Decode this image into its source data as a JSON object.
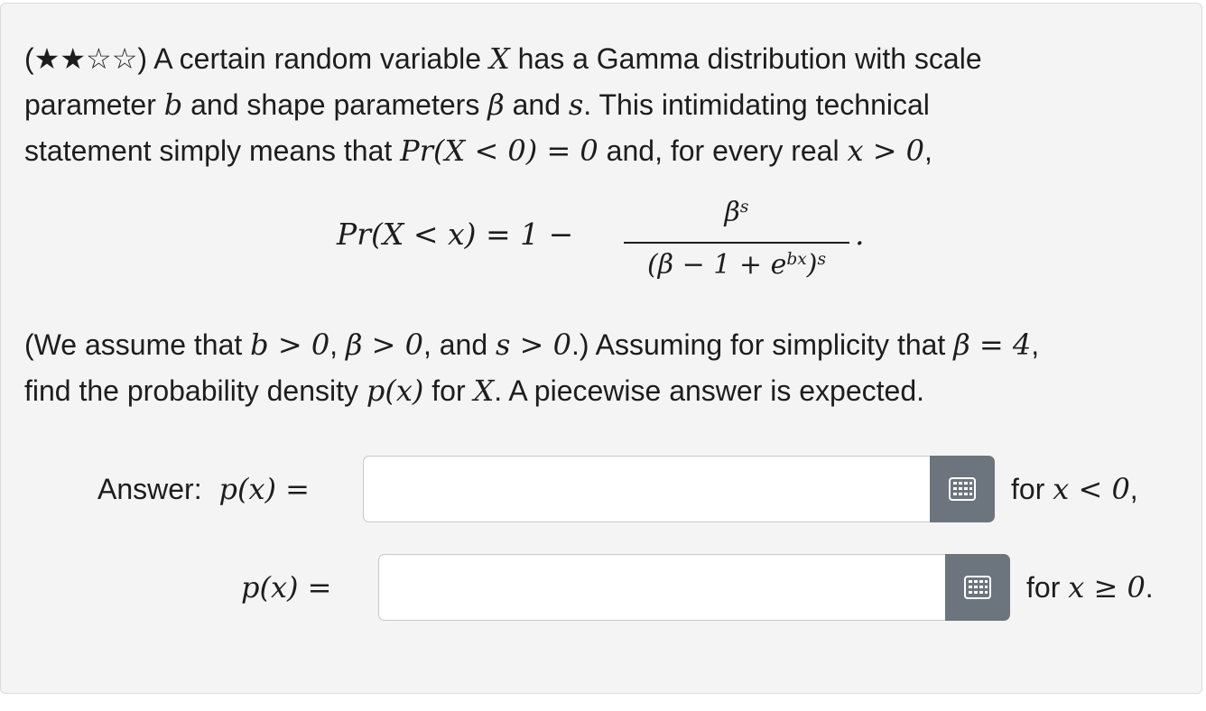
{
  "question": {
    "difficulty_stars": "★★☆☆",
    "line1_text": "A certain random variable",
    "line1_var": "X",
    "line1_tail": "has a Gamma distribution with scale",
    "line2_a": "parameter",
    "line2_b": "b",
    "line2_c": "and shape parameters",
    "line2_beta": "β",
    "line2_and": "and",
    "line2_s": "s",
    "line2_tail": ". This intimidating technical",
    "line3_a": "statement simply means that",
    "line3_expr": "Pr(X < 0) = 0",
    "line3_b": "and, for every real",
    "line3_cond": "x > 0",
    "line3_comma": ",",
    "display_lhs": "Pr(X < x) = 1 −",
    "display_num": "β",
    "display_num_sup": "s",
    "display_den": "(β − 1 + e",
    "display_den_sup1": "bx",
    "display_den_close": ")",
    "display_den_sup2": "s",
    "display_period": ".",
    "line4_a": "(We assume that",
    "line4_b_cond": "b > 0",
    "line4_c": ",",
    "line4_beta_cond": "β > 0",
    "line4_d": ", and",
    "line4_s_cond": "s > 0",
    "line4_e": ".) Assuming for simplicity that",
    "line4_beta_val": "β = 4",
    "line4_f": ",",
    "line5_a": "find the probability density",
    "line5_px": "p(x)",
    "line5_b": "for",
    "line5_X": "X",
    "line5_c": ". A piecewise answer is expected."
  },
  "answers": {
    "label": "Answer:",
    "px_eq": "p(x) =",
    "first": {
      "value": "",
      "for_text": "for",
      "cond": "x < 0",
      "punct": ","
    },
    "second": {
      "value": "",
      "for_text": "for",
      "cond": "x ≥ 0",
      "punct": "."
    }
  },
  "icons": {
    "keyboard": "keyboard-grid-icon"
  },
  "colors": {
    "card_bg": "#f4f4f4",
    "button_bg": "#6c757d",
    "text": "#1d1d1d"
  }
}
